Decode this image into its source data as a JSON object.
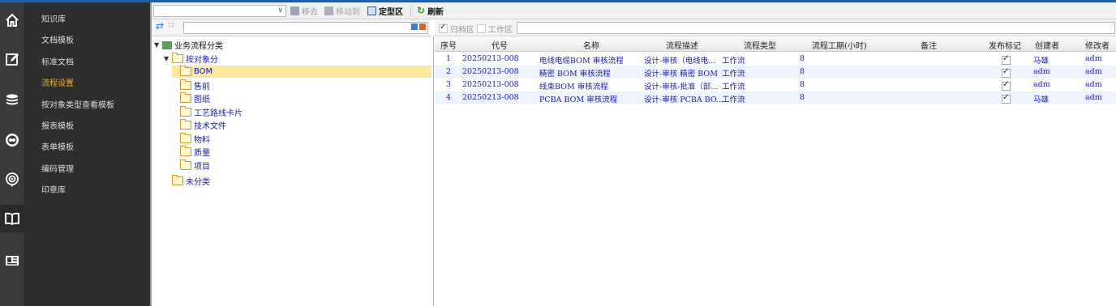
{
  "sidebar": {
    "icons": [
      "home-icon",
      "edit-icon",
      "database-icon",
      "chat-icon",
      "broadcast-icon",
      "book-icon",
      "id-card-icon"
    ],
    "menu": [
      "知识库",
      "文档模板",
      "标准文档",
      "流程设置",
      "按对象类型查看模板",
      "报表模板",
      "表单模板",
      "编码管理",
      "印章库"
    ]
  },
  "toolbar": {
    "move_out": "移去",
    "move_to": "移动到",
    "define_zone": "定型区",
    "refresh": "刷新"
  },
  "tree": {
    "root": "业务流程分类",
    "by_object": "按对象分",
    "children": [
      "BOM",
      "售前",
      "图纸",
      "工艺路线卡片",
      "技术文件",
      "物料",
      "质量",
      "项目"
    ],
    "unclassified": "未分类"
  },
  "filter": {
    "archive_label": "归档区",
    "work_label": "工作区"
  },
  "grid": {
    "headers": [
      "序号",
      "代号",
      "名称",
      "流程描述",
      "流程类型",
      "流程工期(小时)",
      "备注",
      "发布标记",
      "创建者",
      "修改者"
    ],
    "rows": [
      {
        "no": "1",
        "code": "20250213-008",
        "name": "电线电缆BOM 审核流程",
        "desc": "设计-审核（电线电...",
        "type": "工作流",
        "days": "8",
        "note": "",
        "published": true,
        "creator": "马雄",
        "modifier": "adm"
      },
      {
        "no": "2",
        "code": "20250213-008",
        "name": "精密 BOM 审核流程",
        "desc": "设计-审核 精密 BOM",
        "type": "工作流",
        "days": "8",
        "note": "",
        "published": true,
        "creator": "adm",
        "modifier": "adm"
      },
      {
        "no": "3",
        "code": "20250213-008",
        "name": "线束BOM 审核流程",
        "desc": "设计-审核-批准（部...",
        "type": "工作流",
        "days": "8",
        "note": "",
        "published": true,
        "creator": "adm",
        "modifier": "adm"
      },
      {
        "no": "4",
        "code": "20250213-008",
        "name": "PCBA BOM 审核流程",
        "desc": "设计-审核 PCBA BO...",
        "type": "工作流",
        "days": "8",
        "note": "",
        "published": true,
        "creator": "马雄",
        "modifier": "adm"
      }
    ]
  }
}
